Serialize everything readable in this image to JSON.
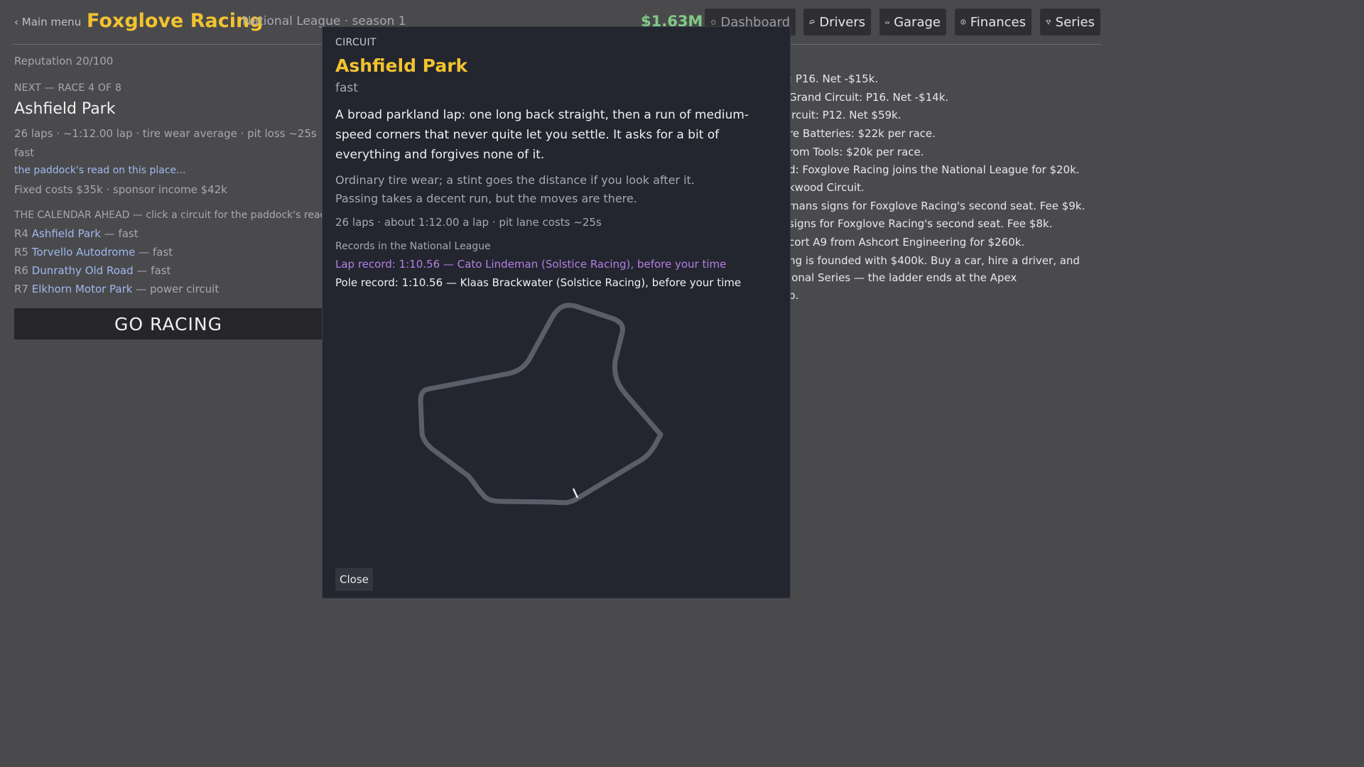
{
  "header": {
    "back_label": "‹ Main menu",
    "team_name": "Foxglove Racing",
    "league_info": "National League · season 1",
    "money": "$1.63M",
    "nav": [
      {
        "label": "Dashboard",
        "icon": "home-icon"
      },
      {
        "label": "Drivers",
        "icon": "helmet-icon"
      },
      {
        "label": "Garage",
        "icon": "car-icon"
      },
      {
        "label": "Finances",
        "icon": "coin-icon"
      },
      {
        "label": "Series",
        "icon": "trophy-icon"
      }
    ]
  },
  "dashboard": {
    "reputation": "Reputation 20/100",
    "next_label": "NEXT — RACE 4 OF 8",
    "next_circuit": "Ashfield Park",
    "next_stats": "26 laps · ~1:12.00 lap · tire wear average · pit loss ~25s",
    "next_type": "fast",
    "paddock_link": "the paddock's read on this place...",
    "costs": "Fixed costs $35k · sponsor income $42k",
    "calendar_label": "THE CALENDAR AHEAD — click a circuit for the paddock's read",
    "calendar": [
      {
        "round": "R4",
        "name": "Ashfield Park",
        "type": "— fast"
      },
      {
        "round": "R5",
        "name": "Torvello Autodrome",
        "type": "— fast"
      },
      {
        "round": "R6",
        "name": "Dunrathy Old Road",
        "type": "— fast"
      },
      {
        "round": "R7",
        "name": "Elkhorn Motor Park",
        "type": "— power circuit"
      }
    ],
    "go_racing": "GO RACING"
  },
  "news_log": [
    "; P16. Net -$15k.",
    "Grand Circuit: P16. Net -$14k.",
    "ircuit: P12. Net $59k.",
    "re Batteries: $22k per race.",
    "rom Tools: $20k per race.",
    "d: Foxglove Racing joins the National League for $20k.",
    "kwood Circuit.",
    "mans signs for Foxglove Racing's second seat. Fee $9k.",
    "signs for Foxglove Racing's second seat. Fee $8k.",
    "cort A9 from Ashcort Engineering for $260k.",
    "ng is founded with $400k. Buy a car, hire a driver, and",
    "ional Series — the ladder ends at the Apex",
    "p."
  ],
  "modal": {
    "kicker": "CIRCUIT",
    "title": "Ashfield Park",
    "type": "fast",
    "description": "A broad parkland lap: one long back straight, then a run of medium-speed corners that never quite let you settle. It asks for a bit of everything and forgives none of it.",
    "tire_note": "Ordinary tire wear; a stint goes the distance if you look after it.",
    "passing_note": "Passing takes a decent run, but the moves are there.",
    "stats": "26 laps · about 1:12.00 a lap · pit lane costs ~25s",
    "records_label": "Records in the National League",
    "lap_record": "Lap record: 1:10.56 — Cato Lindeman (Solstice Racing), before your time",
    "pole_record": "Pole record: 1:10.56 — Klaas Brackwater (Solstice Racing), before your time",
    "close_label": "Close"
  },
  "colors": {
    "accent": "#f2c230",
    "link": "#9fb8f0",
    "money": "#7fcb85",
    "lap_record": "#b57ee6",
    "track": "#5a5e6a"
  }
}
